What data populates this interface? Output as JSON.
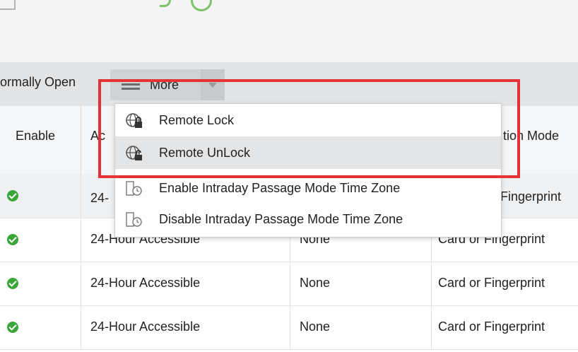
{
  "colors": {
    "accent_red": "#e53236",
    "toolbar_bg": "#e2e4e6",
    "check_green": "#3aa63a",
    "menu_hover": "#e4e5e7"
  },
  "toolbar": {
    "normally_open_label": "ormally Open",
    "more_label": "More",
    "more_icon": "hamburger-menu-icon",
    "caret_icon": "caret-down-icon"
  },
  "table": {
    "headers": {
      "enable": "Enable",
      "access": "Ac",
      "verification": "tion Mode"
    },
    "rows": [
      {
        "time_zone": "24-",
        "passage": "",
        "verify": "Fingerprint"
      },
      {
        "time_zone": "24-Hour Accessible",
        "passage": "None",
        "verify": "Card or Fingerprint"
      },
      {
        "time_zone": "24-Hour Accessible",
        "passage": "None",
        "verify": "Card or Fingerprint"
      },
      {
        "time_zone": "24-Hour Accessible",
        "passage": "None",
        "verify": "Card or Fingerprint"
      }
    ]
  },
  "menu": {
    "items": [
      {
        "label": "Remote Lock",
        "icon": "globe-lock-icon"
      },
      {
        "label": "Remote UnLock",
        "icon": "globe-unlock-icon"
      },
      {
        "label": "Enable Intraday Passage Mode Time Zone",
        "icon": "door-clock-icon"
      },
      {
        "label": "Disable Intraday Passage Mode Time Zone",
        "icon": "door-clock-icon"
      }
    ]
  }
}
